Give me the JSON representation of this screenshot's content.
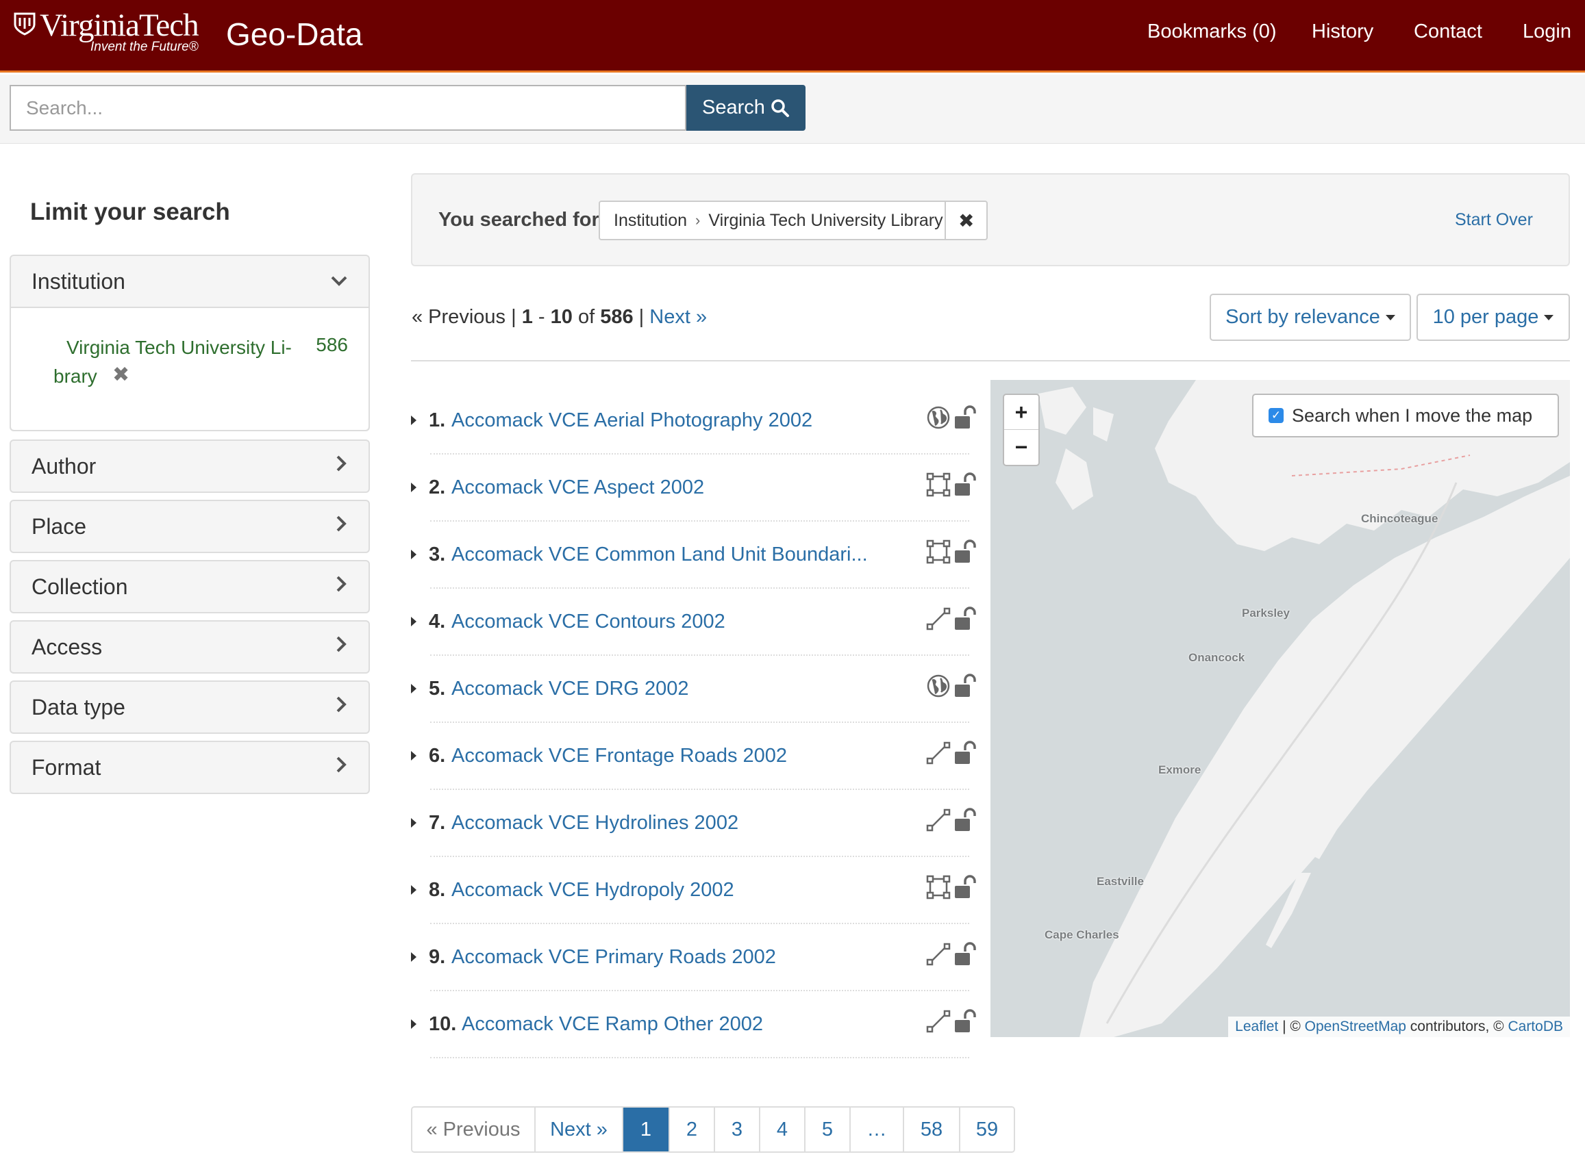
{
  "header": {
    "logo_name": "VirginiaTech",
    "logo_tagline": "Invent the Future®",
    "site_title": "Geo-Data",
    "nav": [
      "Bookmarks (0)",
      "History",
      "Contact",
      "Login"
    ]
  },
  "search": {
    "placeholder": "Search...",
    "button_label": "Search"
  },
  "sidebar": {
    "heading": "Limit your search",
    "facets": [
      {
        "label": "Institution",
        "expanded": true,
        "values": [
          {
            "line1": "Virginia Tech University Li-",
            "line2": "brary",
            "count": "586"
          }
        ]
      },
      {
        "label": "Author"
      },
      {
        "label": "Place"
      },
      {
        "label": "Collection"
      },
      {
        "label": "Access"
      },
      {
        "label": "Data type"
      },
      {
        "label": "Format"
      }
    ]
  },
  "constraints": {
    "lead": "You searched for:",
    "field": "Institution",
    "value": "Virginia Tech University Library",
    "start_over": "Start Over"
  },
  "paging": {
    "prev": "« Previous",
    "sep": "|",
    "start": "1",
    "dash": "-",
    "end": "10",
    "of": "of",
    "total": "586",
    "next": "Next »",
    "sort_label": "Sort by relevance",
    "per_page_label": "10 per page"
  },
  "results": [
    {
      "num": "1.",
      "title": "Accomack VCE Aerial Photography 2002",
      "geom": "raster-icon"
    },
    {
      "num": "2.",
      "title": "Accomack VCE Aspect 2002",
      "geom": "polygon-icon"
    },
    {
      "num": "3.",
      "title": "Accomack VCE Common Land Unit Boundari...",
      "geom": "polygon-icon"
    },
    {
      "num": "4.",
      "title": "Accomack VCE Contours 2002",
      "geom": "line-icon"
    },
    {
      "num": "5.",
      "title": "Accomack VCE DRG 2002",
      "geom": "raster-icon"
    },
    {
      "num": "6.",
      "title": "Accomack VCE Frontage Roads 2002",
      "geom": "line-icon"
    },
    {
      "num": "7.",
      "title": "Accomack VCE Hydrolines 2002",
      "geom": "line-icon"
    },
    {
      "num": "8.",
      "title": "Accomack VCE Hydropoly 2002",
      "geom": "polygon-icon"
    },
    {
      "num": "9.",
      "title": "Accomack VCE Primary Roads 2002",
      "geom": "line-icon"
    },
    {
      "num": "10.",
      "title": "Accomack VCE Ramp Other 2002",
      "geom": "line-icon"
    }
  ],
  "map": {
    "zoom_in": "+",
    "zoom_out": "−",
    "search_when_label": "Search when I move the map",
    "search_when_checked": true,
    "places": [
      "Chincoteague",
      "Parksley",
      "Onancock",
      "Exmore",
      "Eastville",
      "Cape Charles"
    ],
    "attribution": {
      "leaflet": "Leaflet",
      "sep": " | © ",
      "osm": "OpenStreetMap",
      "mid": " contributors, © ",
      "carto": "CartoDB"
    }
  },
  "pagination": {
    "prev": "« Previous",
    "next": "Next »",
    "pages": [
      "1",
      "2",
      "3",
      "4",
      "5",
      "…",
      "58",
      "59"
    ],
    "current": "1"
  },
  "colors": {
    "header_bg": "#6b0000",
    "header_accent": "#e87722",
    "link": "#2a6ea6",
    "search_button": "#2b5574",
    "facet_value": "#2e6e2e"
  }
}
